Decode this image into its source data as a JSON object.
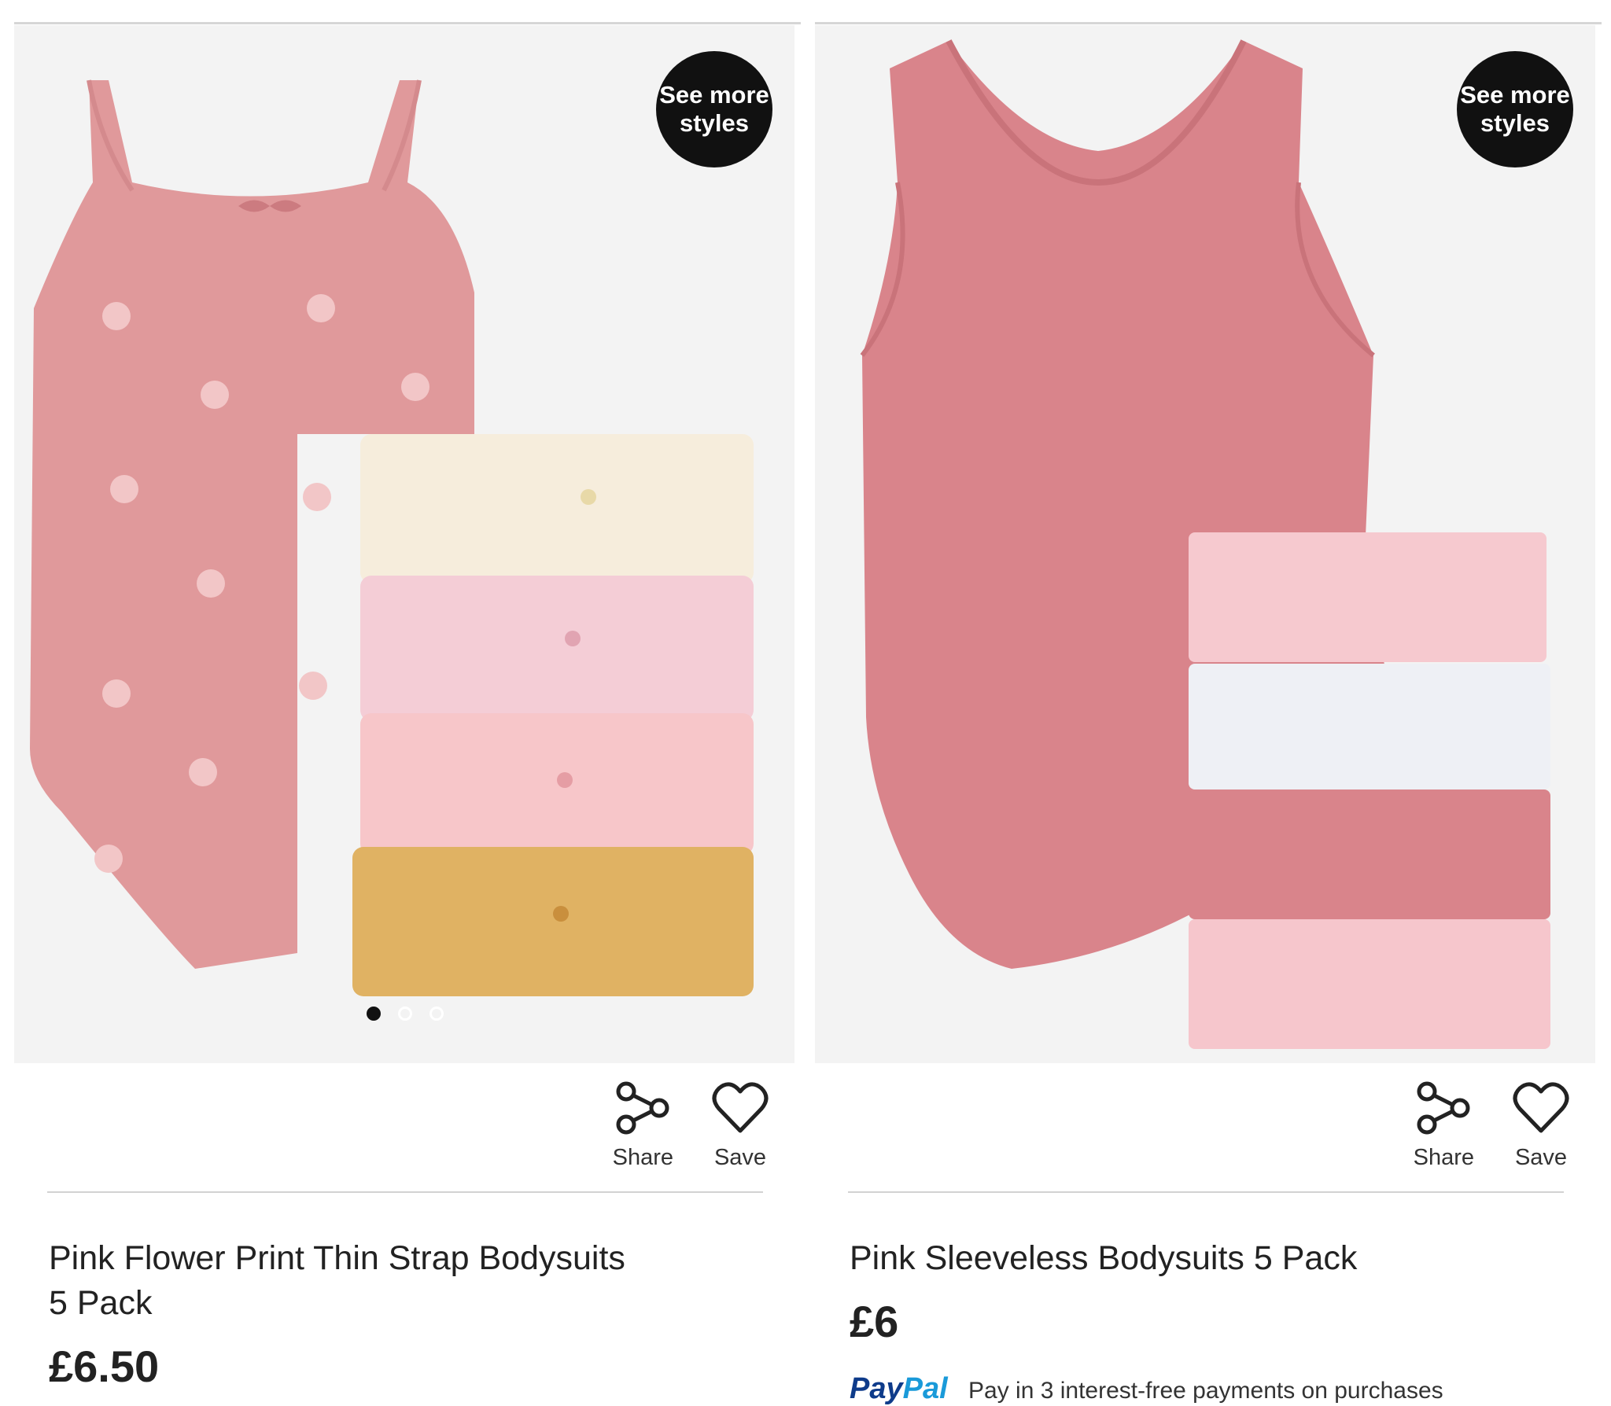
{
  "products": [
    {
      "badge": "See more\nstyles",
      "title_line1": "Pink Flower Print Thin Strap Bodysuits",
      "title_line2": "5 Pack",
      "price": "£6.50",
      "share_label": "Share",
      "save_label": "Save",
      "carousel": {
        "count": 3,
        "active": 1
      }
    },
    {
      "badge": "See more\nstyles",
      "title_line1": "Pink Sleeveless Bodysuits 5 Pack",
      "price": "£6",
      "share_label": "Share",
      "save_label": "Save"
    }
  ],
  "paypal": {
    "logo_pay": "Pay",
    "logo_pal": "Pal",
    "text": "Pay in 3 interest-free payments on purchases"
  },
  "colors": {
    "badge_bg": "#111111",
    "bodysuit_pink": "#e0999b",
    "solid_pink": "#d9848b",
    "image_bg": "#f3f3f3"
  }
}
